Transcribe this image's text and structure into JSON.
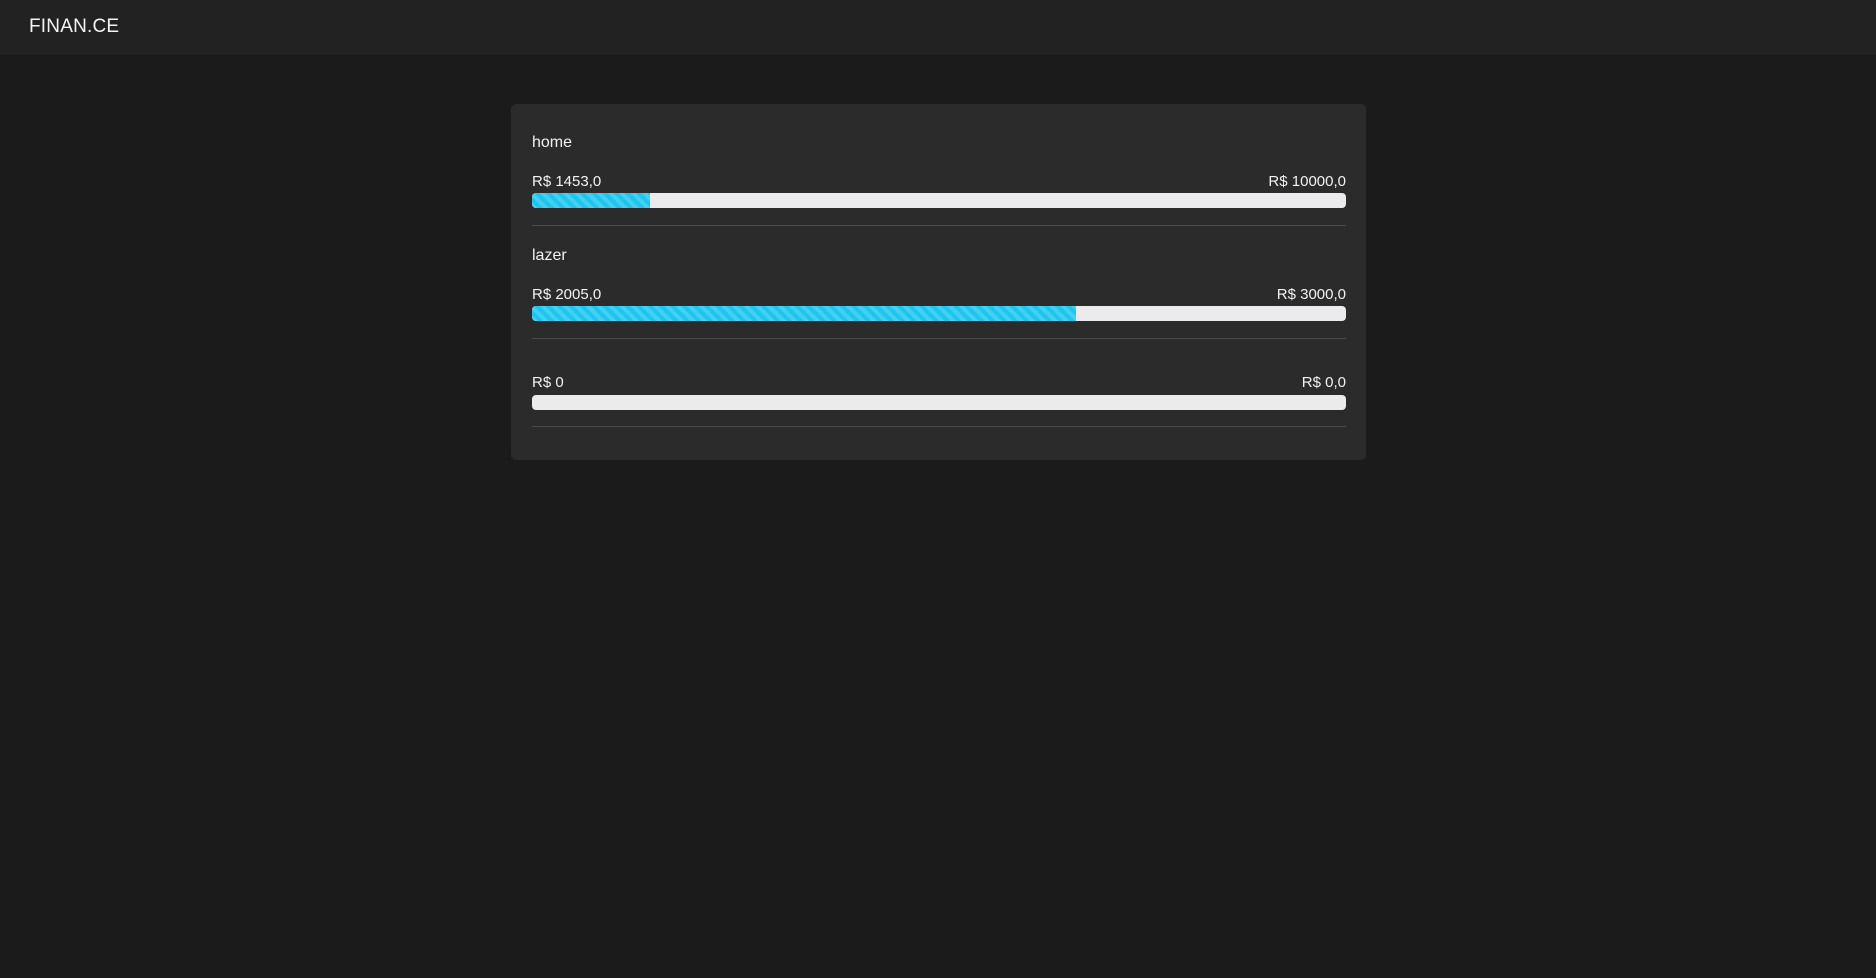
{
  "app": {
    "brand": "FINAN.CE"
  },
  "colors": {
    "background": "#1c1b1c",
    "topbar": "#222222",
    "card": "#2b2b2b",
    "progress_fill": "#1cc6ee",
    "progress_track": "#ebebed"
  },
  "budgets": [
    {
      "name": "home",
      "spent": "R$ 1453,0",
      "limit": "R$ 10000,0",
      "progress": 0.1453
    },
    {
      "name": "lazer",
      "spent": "R$ 2005,0",
      "limit": "R$ 3000,0",
      "progress": 0.6683
    },
    {
      "name": "",
      "spent": "R$ 0",
      "limit": "R$ 0,0",
      "progress": 0
    }
  ]
}
